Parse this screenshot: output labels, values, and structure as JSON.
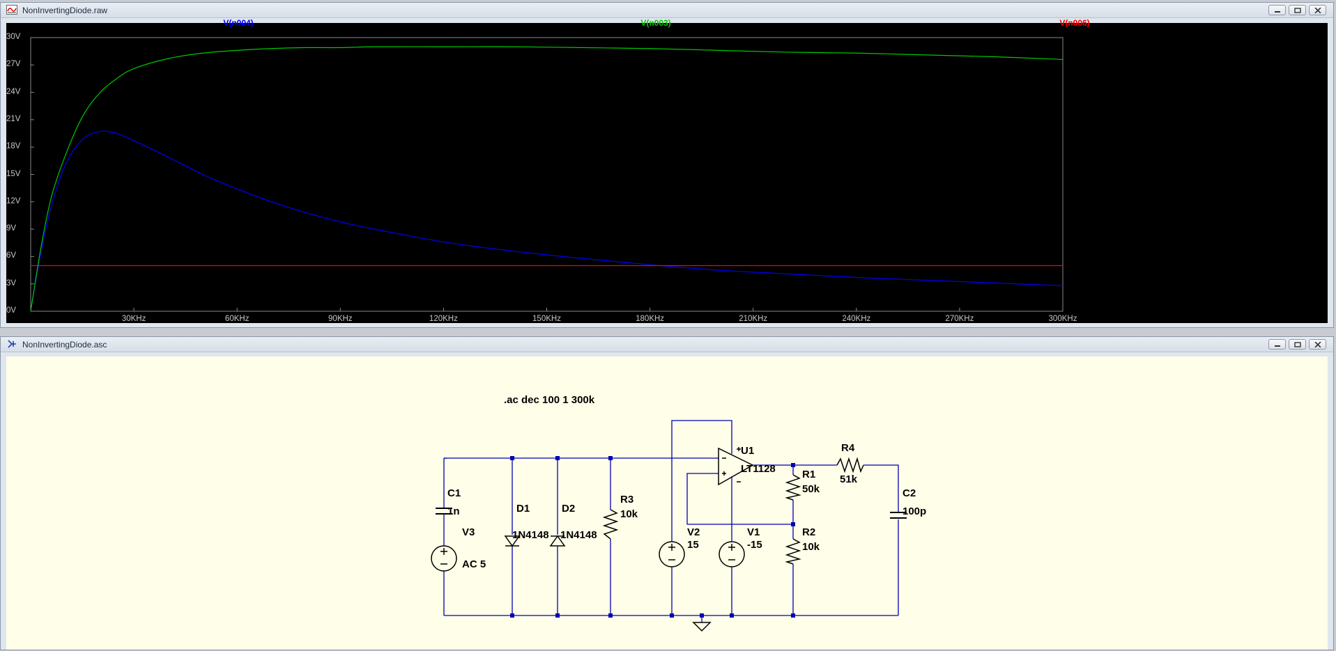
{
  "plot_window": {
    "title": "NonInvertingDiode.raw",
    "traces": [
      {
        "label": "V(n004)",
        "color": "#0000ff"
      },
      {
        "label": "V(n003)",
        "color": "#00c800"
      },
      {
        "label": "V(n006)",
        "color": "#ff0000"
      }
    ]
  },
  "schematic_window": {
    "title": "NonInvertingDiode.asc",
    "directive": ".ac dec 100 1 300k",
    "labels": {
      "c1_name": "C1",
      "c1_value": "1n",
      "v3_name": "V3",
      "v3_value": "AC 5",
      "d1_name": "D1",
      "d1_value": "1N4148",
      "d2_name": "D2",
      "d2_value": "1N4148",
      "r3_name": "R3",
      "r3_value": "10k",
      "v2_name": "V2",
      "v2_value": "15",
      "v1_name": "V1",
      "v1_value": "-15",
      "u1_name": "U1",
      "u1_value": "LT1128",
      "r1_name": "R1",
      "r1_value": "50k",
      "r2_name": "R2",
      "r2_value": "10k",
      "r4_name": "R4",
      "r4_value": "51k",
      "c2_name": "C2",
      "c2_value": "100p"
    },
    "wire_color": "#0000b4"
  },
  "chart_data": {
    "type": "line",
    "title": "",
    "xlabel": "",
    "ylabel": "",
    "xlim": [
      0,
      300
    ],
    "ylim": [
      0,
      30
    ],
    "x_ticks": [
      "30KHz",
      "60KHz",
      "90KHz",
      "120KHz",
      "150KHz",
      "180KHz",
      "210KHz",
      "240KHz",
      "270KHz",
      "300KHz"
    ],
    "y_ticks": [
      "0V",
      "3V",
      "6V",
      "9V",
      "12V",
      "15V",
      "18V",
      "21V",
      "24V",
      "27V",
      "30V"
    ],
    "x_unit": "KHz",
    "y_unit": "V",
    "grid": false,
    "series": [
      {
        "name": "V(n004)",
        "color": "#0000ff",
        "x": [
          0,
          3,
          6,
          10,
          15,
          20,
          25,
          30,
          40,
          50,
          60,
          70,
          80,
          90,
          100,
          120,
          140,
          160,
          180,
          200,
          220,
          240,
          260,
          280,
          300
        ],
        "y": [
          0,
          6.5,
          11.5,
          16.0,
          18.8,
          19.7,
          19.5,
          18.7,
          16.9,
          15.0,
          13.4,
          12.0,
          10.8,
          9.8,
          9.0,
          7.6,
          6.6,
          5.8,
          5.1,
          4.5,
          4.1,
          3.7,
          3.4,
          3.1,
          2.8
        ]
      },
      {
        "name": "V(n003)",
        "color": "#00c800",
        "x": [
          0,
          3,
          6,
          10,
          15,
          20,
          25,
          30,
          40,
          50,
          60,
          70,
          80,
          90,
          100,
          120,
          140,
          160,
          180,
          200,
          220,
          240,
          260,
          280,
          300
        ],
        "y": [
          0,
          7.0,
          12.5,
          17.0,
          21.3,
          23.9,
          25.5,
          26.6,
          27.7,
          28.3,
          28.6,
          28.8,
          28.9,
          28.9,
          29.0,
          29.0,
          29.0,
          28.9,
          28.8,
          28.6,
          28.4,
          28.3,
          28.1,
          27.9,
          27.6
        ]
      },
      {
        "name": "V(n006)",
        "color": "#ff0000",
        "x": [
          0,
          300
        ],
        "y": [
          5,
          5
        ]
      }
    ]
  }
}
